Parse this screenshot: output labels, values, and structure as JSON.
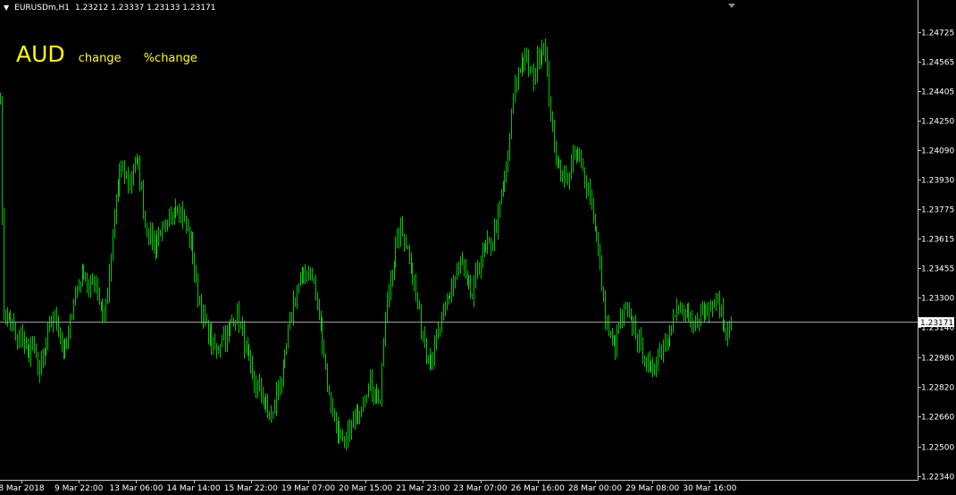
{
  "header": {
    "symbol": "EURUSDm,H1",
    "ohlc": "1.23212 1.23337 1.23133 1.23171"
  },
  "overlay": {
    "currency": "AUD",
    "change_label": "change",
    "pct_change_label": "%change"
  },
  "colors": {
    "background": "#000000",
    "bars": "#00c800",
    "axis": "#c0c0c0",
    "text": "#ffffff",
    "overlay": "#ffff00",
    "current_line": "#a0a0a0"
  },
  "chart_data": {
    "type": "ohlc",
    "title": "",
    "xlabel": "",
    "ylabel": "",
    "ylim": [
      1.2234,
      1.248
    ],
    "yticks": [
      "1.24725",
      "1.24565",
      "1.24405",
      "1.24250",
      "1.24090",
      "1.23930",
      "1.23775",
      "1.23615",
      "1.23455",
      "1.23300",
      "1.23140",
      "1.22980",
      "1.22820",
      "1.22660",
      "1.22500",
      "1.22340"
    ],
    "xticks": [
      "8 Mar 2018",
      "9 Mar 22:00",
      "13 Mar 06:00",
      "14 Mar 14:00",
      "15 Mar 22:00",
      "19 Mar 07:00",
      "20 Mar 15:00",
      "21 Mar 23:00",
      "23 Mar 07:00",
      "26 Mar 16:00",
      "28 Mar 00:00",
      "29 Mar 08:00",
      "30 Mar 16:00"
    ],
    "current_price": "1.23171",
    "current_value": 1.23171,
    "close_anchors": [
      [
        0,
        1.244
      ],
      [
        1,
        1.237
      ],
      [
        2,
        1.232
      ],
      [
        6,
        1.2318
      ],
      [
        10,
        1.2305
      ],
      [
        13,
        1.231
      ],
      [
        16,
        1.2298
      ],
      [
        19,
        1.2305
      ],
      [
        22,
        1.2292
      ],
      [
        25,
        1.2295
      ],
      [
        28,
        1.231
      ],
      [
        31,
        1.232
      ],
      [
        34,
        1.2315
      ],
      [
        37,
        1.23
      ],
      [
        40,
        1.2308
      ],
      [
        43,
        1.233
      ],
      [
        46,
        1.2338
      ],
      [
        49,
        1.2345
      ],
      [
        52,
        1.2333
      ],
      [
        55,
        1.234
      ],
      [
        58,
        1.2328
      ],
      [
        61,
        1.232
      ],
      [
        64,
        1.234
      ],
      [
        67,
        1.2372
      ],
      [
        70,
        1.2398
      ],
      [
        73,
        1.2395
      ],
      [
        76,
        1.239
      ],
      [
        79,
        1.2405
      ],
      [
        82,
        1.2395
      ],
      [
        85,
        1.237
      ],
      [
        88,
        1.2363
      ],
      [
        91,
        1.2358
      ],
      [
        94,
        1.2368
      ],
      [
        97,
        1.2363
      ],
      [
        100,
        1.2373
      ],
      [
        103,
        1.238
      ],
      [
        106,
        1.2376
      ],
      [
        109,
        1.2368
      ],
      [
        112,
        1.2358
      ],
      [
        115,
        1.2338
      ],
      [
        118,
        1.2323
      ],
      [
        121,
        1.2313
      ],
      [
        124,
        1.2305
      ],
      [
        127,
        1.23
      ],
      [
        130,
        1.231
      ],
      [
        133,
        1.2308
      ],
      [
        136,
        1.2318
      ],
      [
        139,
        1.2322
      ],
      [
        142,
        1.231
      ],
      [
        145,
        1.2298
      ],
      [
        148,
        1.2286
      ],
      [
        151,
        1.2282
      ],
      [
        154,
        1.2276
      ],
      [
        157,
        1.2268
      ],
      [
        160,
        1.2266
      ],
      [
        163,
        1.2283
      ],
      [
        166,
        1.229
      ],
      [
        169,
        1.231
      ],
      [
        172,
        1.2328
      ],
      [
        175,
        1.2336
      ],
      [
        178,
        1.2343
      ],
      [
        181,
        1.2344
      ],
      [
        184,
        1.2338
      ],
      [
        187,
        1.232
      ],
      [
        190,
        1.23
      ],
      [
        193,
        1.2276
      ],
      [
        196,
        1.2266
      ],
      [
        199,
        1.2256
      ],
      [
        202,
        1.2248
      ],
      [
        205,
        1.226
      ],
      [
        208,
        1.2264
      ],
      [
        211,
        1.2272
      ],
      [
        214,
        1.228
      ],
      [
        217,
        1.2283
      ],
      [
        220,
        1.2278
      ],
      [
        223,
        1.2275
      ],
      [
        226,
        1.232
      ],
      [
        229,
        1.234
      ],
      [
        232,
        1.2357
      ],
      [
        235,
        1.2365
      ],
      [
        238,
        1.236
      ],
      [
        241,
        1.235
      ],
      [
        244,
        1.233
      ],
      [
        247,
        1.2315
      ],
      [
        250,
        1.23
      ],
      [
        253,
        1.2298
      ],
      [
        256,
        1.2306
      ],
      [
        259,
        1.2316
      ],
      [
        262,
        1.2326
      ],
      [
        265,
        1.2336
      ],
      [
        268,
        1.2343
      ],
      [
        271,
        1.2348
      ],
      [
        274,
        1.2336
      ],
      [
        277,
        1.233
      ],
      [
        280,
        1.2346
      ],
      [
        283,
        1.2352
      ],
      [
        286,
        1.2357
      ],
      [
        289,
        1.2361
      ],
      [
        292,
        1.2373
      ],
      [
        295,
        1.239
      ],
      [
        298,
        1.2405
      ],
      [
        301,
        1.2438
      ],
      [
        304,
        1.2452
      ],
      [
        307,
        1.2458
      ],
      [
        310,
        1.2454
      ],
      [
        313,
        1.2448
      ],
      [
        316,
        1.246
      ],
      [
        319,
        1.2468
      ],
      [
        322,
        1.244
      ],
      [
        325,
        1.241
      ],
      [
        328,
        1.24
      ],
      [
        331,
        1.2392
      ],
      [
        334,
        1.2398
      ],
      [
        337,
        1.2405
      ],
      [
        340,
        1.2402
      ],
      [
        343,
        1.2395
      ],
      [
        346,
        1.2385
      ],
      [
        349,
        1.237
      ],
      [
        352,
        1.2345
      ],
      [
        355,
        1.232
      ],
      [
        358,
        1.2308
      ],
      [
        361,
        1.2305
      ],
      [
        364,
        1.2318
      ],
      [
        367,
        1.2322
      ],
      [
        370,
        1.2316
      ],
      [
        373,
        1.2312
      ],
      [
        376,
        1.2302
      ],
      [
        379,
        1.2296
      ],
      [
        382,
        1.229
      ],
      [
        385,
        1.2298
      ],
      [
        388,
        1.2302
      ],
      [
        391,
        1.2308
      ],
      [
        394,
        1.2318
      ],
      [
        397,
        1.2322
      ],
      [
        400,
        1.2322
      ],
      [
        403,
        1.2318
      ],
      [
        406,
        1.2314
      ],
      [
        409,
        1.2318
      ],
      [
        412,
        1.2322
      ],
      [
        415,
        1.2322
      ],
      [
        418,
        1.233
      ],
      [
        421,
        1.233
      ],
      [
        424,
        1.232
      ],
      [
        427,
        1.231
      ],
      [
        429,
        1.2317
      ]
    ]
  }
}
